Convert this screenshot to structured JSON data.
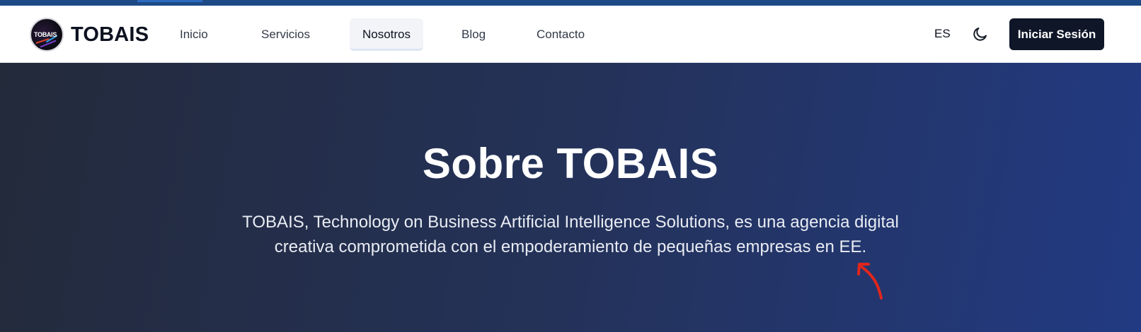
{
  "header": {
    "brand": "TOBAIS",
    "logo_text": "TOBAIS",
    "nav": [
      {
        "label": "Inicio"
      },
      {
        "label": "Servicios"
      },
      {
        "label": "Nosotros",
        "active": true
      },
      {
        "label": "Blog"
      },
      {
        "label": "Contacto"
      }
    ],
    "language": "ES",
    "theme_icon": "moon-icon",
    "login_label": "Iniciar Sesión"
  },
  "hero": {
    "title": "Sobre TOBAIS",
    "description": "TOBAIS, Technology on Business Artificial Intelligence Solutions, es una agencia digital creativa comprometida con el empoderamiento de pequeñas empresas en EE."
  },
  "colors": {
    "primary_dark": "#0f1628",
    "hero_start": "#232a3a",
    "hero_end": "#223a82",
    "annotation": "#e0261d"
  }
}
